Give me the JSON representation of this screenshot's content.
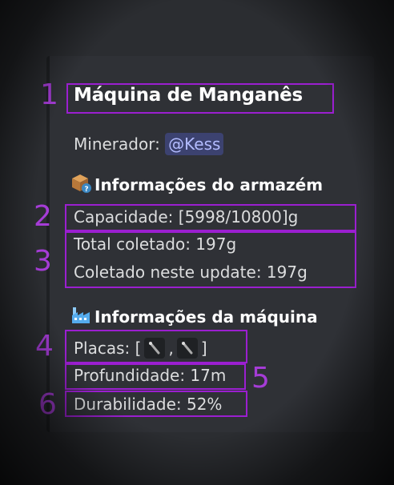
{
  "title": "Máquina de Manganês",
  "miner_label": "Minerador:",
  "miner_mention": "@Kess",
  "storage_section": "Informações do armazém",
  "capacity": "Capacidade: [5998/10800]g",
  "total_collected": "Total coletado: 197g",
  "collected_update": "Coletado neste update: 197g",
  "machine_section": "Informações da máquina",
  "plates_prefix": "Placas: [",
  "plates_sep": ",",
  "plates_suffix": "]",
  "depth": "Profundidade: 17m",
  "durability": "Durabilidade: 52%",
  "annotations": [
    "1",
    "2",
    "3",
    "4",
    "5",
    "6"
  ],
  "colors": {
    "annotation": "#9b1fd0",
    "mention_bg": "#3c4270",
    "mention_text": "#b3bcff"
  },
  "icons": {
    "storage": "package-question-icon",
    "machine": "factory-icon",
    "plate": "plate-item-icon"
  }
}
